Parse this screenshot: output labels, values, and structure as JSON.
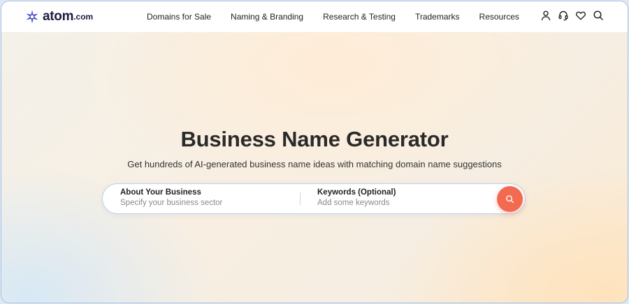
{
  "brand": {
    "name": "atom",
    "tld": ".com",
    "accent_color": "#1d1d3f",
    "mark_color": "#4a4fc9"
  },
  "nav": {
    "items": [
      {
        "label": "Domains for Sale"
      },
      {
        "label": "Naming & Branding"
      },
      {
        "label": "Research & Testing"
      },
      {
        "label": "Trademarks"
      },
      {
        "label": "Resources"
      }
    ],
    "icons": [
      "user-icon",
      "headset-icon",
      "heart-icon",
      "search-icon"
    ]
  },
  "hero": {
    "title": "Business Name Generator",
    "subtitle": "Get hundreds of AI-generated business name ideas with matching domain name suggestions"
  },
  "search": {
    "business": {
      "label": "About Your Business",
      "placeholder": "Specify your business sector",
      "value": ""
    },
    "keywords": {
      "label": "Keywords (Optional)",
      "placeholder": "Add some keywords",
      "value": ""
    },
    "button_icon": "search-icon",
    "button_color": "#f26a4f"
  }
}
